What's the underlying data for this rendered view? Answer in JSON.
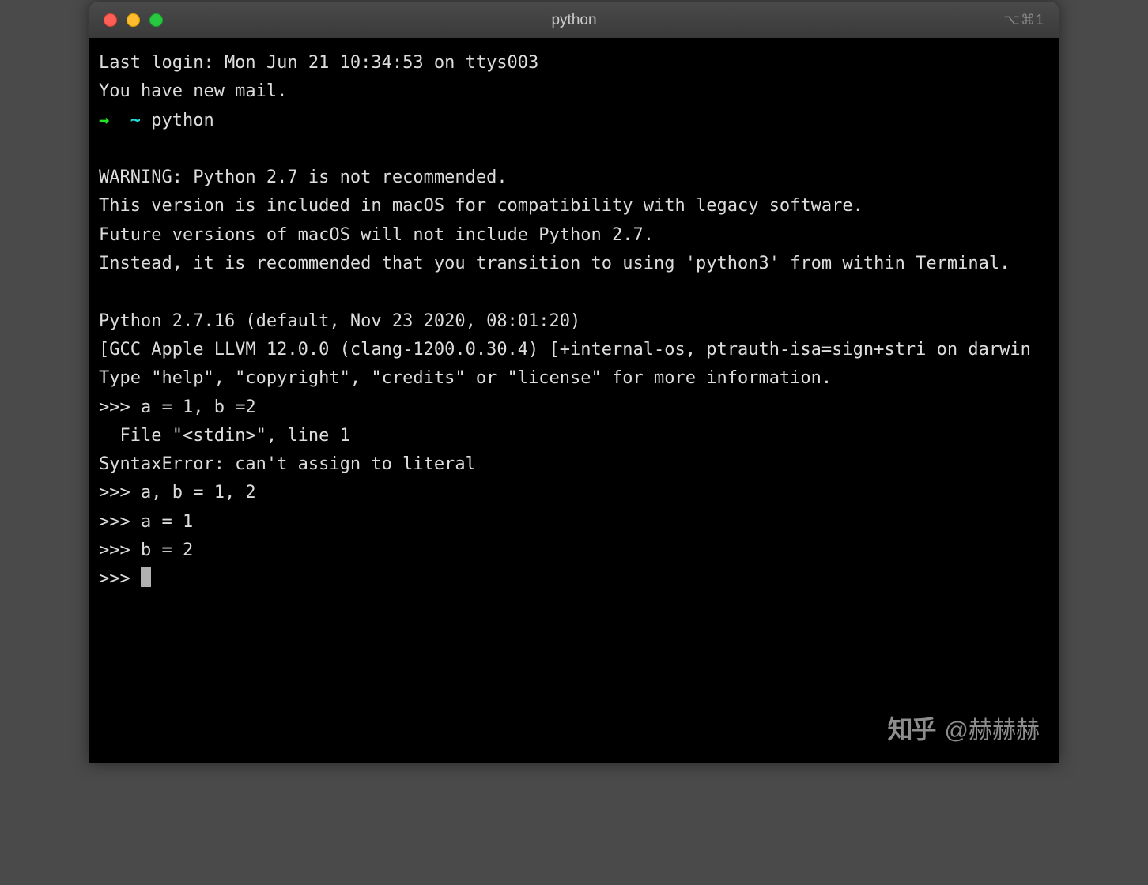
{
  "window": {
    "title": "python",
    "shortcut": "⌥⌘1"
  },
  "terminal": {
    "last_login": "Last login: Mon Jun 21 10:34:53 on ttys003",
    "mail_notice": "You have new mail.",
    "prompt_arrow": "→",
    "prompt_tilde": "~",
    "prompt_command": "python",
    "warning_line1": "WARNING: Python 2.7 is not recommended.",
    "warning_line2": "This version is included in macOS for compatibility with legacy software.",
    "warning_line3": "Future versions of macOS will not include Python 2.7.",
    "warning_line4": "Instead, it is recommended that you transition to using 'python3' from within Terminal.",
    "python_version": "Python 2.7.16 (default, Nov 23 2020, 08:01:20)",
    "compiler_info": "[GCC Apple LLVM 12.0.0 (clang-1200.0.30.4) [+internal-os, ptrauth-isa=sign+stri on darwin",
    "help_line": "Type \"help\", \"copyright\", \"credits\" or \"license\" for more information.",
    "repl_prompt": ">>> ",
    "input1": "a = 1, b =2",
    "error_file": "  File \"<stdin>\", line 1",
    "error_msg": "SyntaxError: can't assign to literal",
    "input2": "a, b = 1, 2",
    "input3": "a = 1",
    "input4": "b = 2"
  },
  "watermark": {
    "icon": "知乎",
    "text": "@赫赫赫"
  }
}
